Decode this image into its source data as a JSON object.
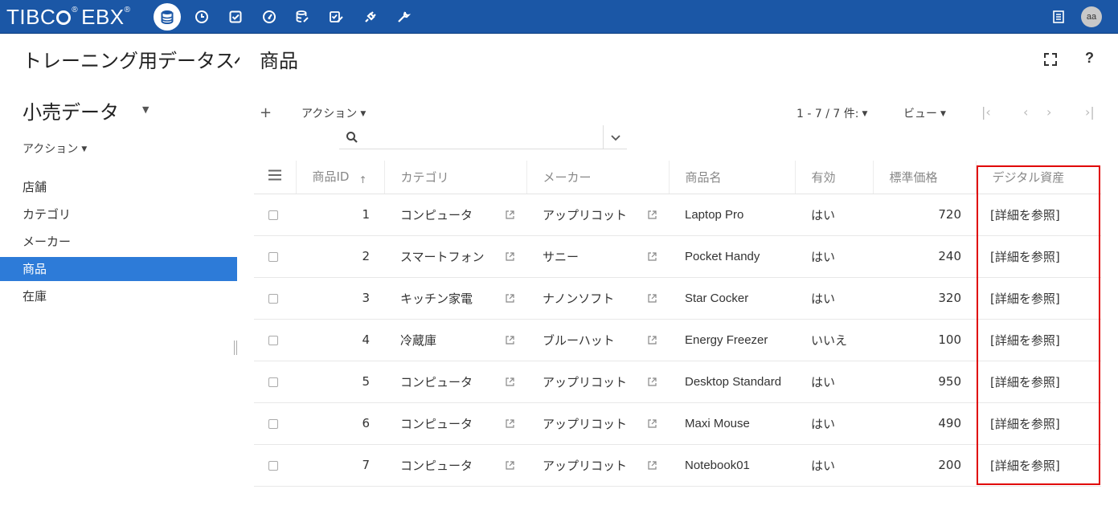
{
  "app": {
    "logo_text": "TIBC",
    "logo_text2": "EBX",
    "avatar_initials": "aa"
  },
  "header": {
    "dataspace_title": "トレーニング用データスペ",
    "table_title": "商品",
    "help_label": "?"
  },
  "sidebar": {
    "dataset_label": "小売データ",
    "actions_label": "アクション",
    "items": [
      {
        "label": "店舗"
      },
      {
        "label": "カテゴリ"
      },
      {
        "label": "メーカー"
      },
      {
        "label": "商品",
        "active": true
      },
      {
        "label": "在庫"
      }
    ]
  },
  "toolbar": {
    "add_label": "+",
    "actions_label": "アクション",
    "search_placeholder": "",
    "pager_label": "1 - 7 / 7 件:",
    "view_label": "ビュー",
    "first_label": "|<",
    "prev_label": "<",
    "next_label": ">",
    "last_label": ">|"
  },
  "table": {
    "columns": [
      "商品ID",
      "カテゴリ",
      "メーカー",
      "商品名",
      "有効",
      "標準価格",
      "デジタル資産"
    ],
    "rows": [
      {
        "id": "1",
        "category": "コンピュータ",
        "maker": "アップリコット",
        "name": "Laptop Pro",
        "valid": "はい",
        "price": "720",
        "asset": "[詳細を参照]"
      },
      {
        "id": "2",
        "category": "スマートフォン",
        "maker": "サニー",
        "name": "Pocket Handy",
        "valid": "はい",
        "price": "240",
        "asset": "[詳細を参照]"
      },
      {
        "id": "3",
        "category": "キッチン家電",
        "maker": "ナノンソフト",
        "name": "Star Cocker",
        "valid": "はい",
        "price": "320",
        "asset": "[詳細を参照]"
      },
      {
        "id": "4",
        "category": "冷蔵庫",
        "maker": "ブルーハット",
        "name": "Energy Freezer",
        "valid": "いいえ",
        "price": "100",
        "asset": "[詳細を参照]"
      },
      {
        "id": "5",
        "category": "コンピュータ",
        "maker": "アップリコット",
        "name": "Desktop Standard",
        "valid": "はい",
        "price": "950",
        "asset": "[詳細を参照]"
      },
      {
        "id": "6",
        "category": "コンピュータ",
        "maker": "アップリコット",
        "name": "Maxi Mouse",
        "valid": "はい",
        "price": "490",
        "asset": "[詳細を参照]"
      },
      {
        "id": "7",
        "category": "コンピュータ",
        "maker": "アップリコット",
        "name": "Notebook01",
        "valid": "はい",
        "price": "200",
        "asset": "[詳細を参照]"
      }
    ]
  },
  "colors": {
    "topbar": "#1b57a6",
    "active_item": "#2d7bd8",
    "highlight": "#e00000"
  },
  "icons": [
    "database-icon",
    "clock-icon",
    "task-check-icon",
    "dashboard-icon",
    "data-model-icon",
    "workflow-icon",
    "plug-icon",
    "wrench-icon",
    "list-icon",
    "fullscreen-icon",
    "search-icon",
    "external-link-icon"
  ]
}
